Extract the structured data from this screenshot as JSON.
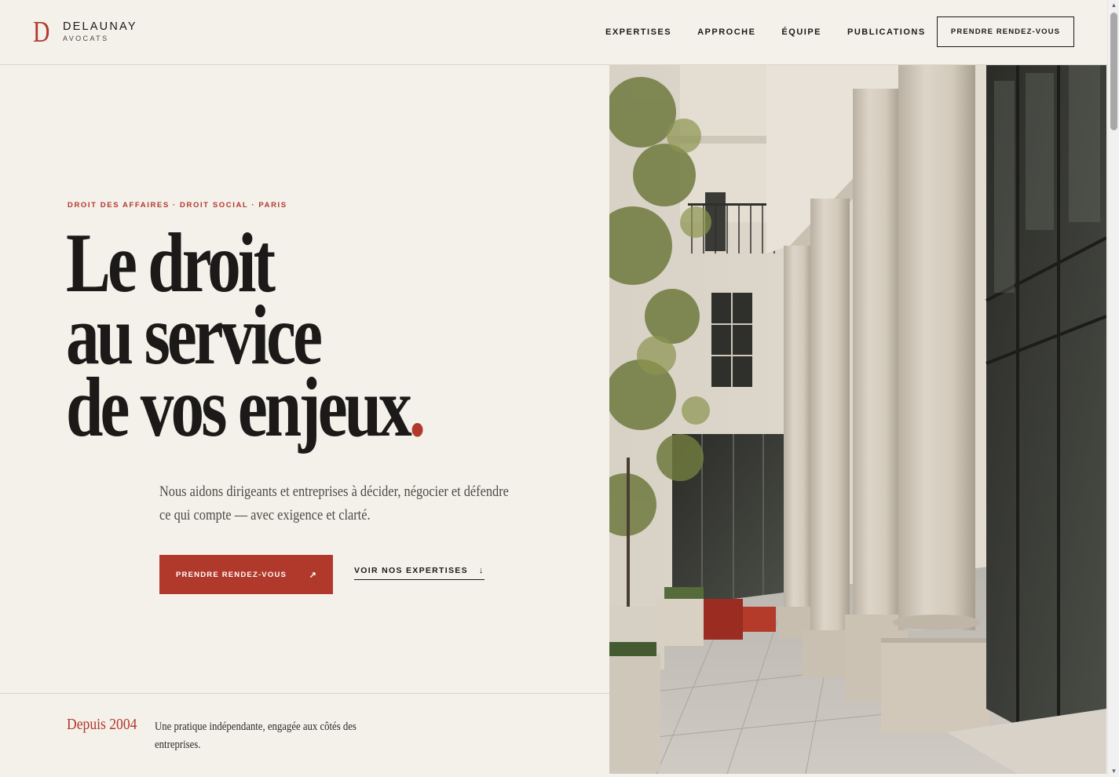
{
  "header": {
    "logo_mark": "D",
    "logo_name": "DELAUNAY",
    "logo_sub": "AVOCATS",
    "nav": [
      {
        "label": "EXPERTISES"
      },
      {
        "label": "APPROCHE"
      },
      {
        "label": "ÉQUIPE"
      },
      {
        "label": "PUBLICATIONS"
      }
    ],
    "cta_label": "PRENDRE RENDEZ-VOUS"
  },
  "hero": {
    "eyebrow": "DROIT DES AFFAIRES · DROIT SOCIAL · PARIS",
    "headline_lines": [
      "Le droit",
      "au service",
      "de vos enjeux"
    ],
    "headline_dot": ".",
    "lede": "Nous aidons dirigeants et entreprises à décider, négocier et défendre ce qui compte — avec exigence et clarté.",
    "primary_button": {
      "label": "PRENDRE RENDEZ-VOUS",
      "icon": "arrow-up-right-icon",
      "glyph": "↗"
    },
    "secondary_link": {
      "label": "VOIR NOS EXPERTISES",
      "icon": "arrow-down-icon",
      "glyph": "↓"
    }
  },
  "strip": {
    "since": "Depuis 2004",
    "description": "Une pratique indépendante, engagée aux côtés des entreprises."
  },
  "scrollbar": {
    "up_glyph": "▲",
    "down_glyph": "▼"
  },
  "colors": {
    "background": "#f4f0ea",
    "accent": "#b1392b",
    "ink": "#1b1a18"
  }
}
